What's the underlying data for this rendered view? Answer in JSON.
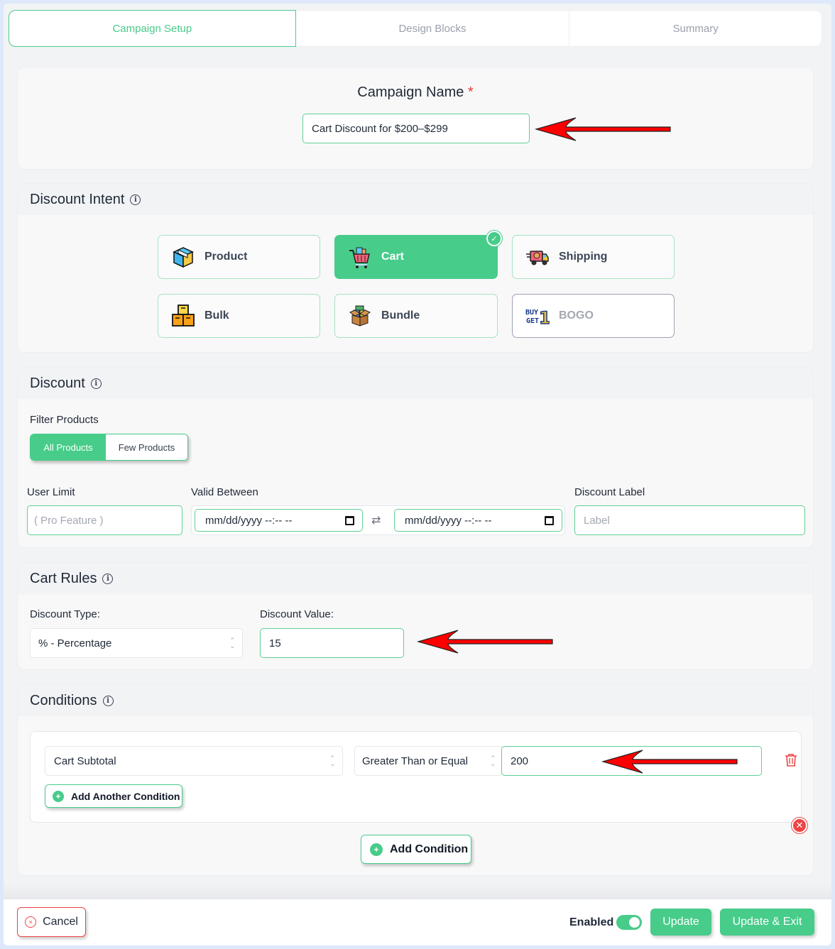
{
  "tabs": [
    {
      "label": "Campaign Setup",
      "active": true
    },
    {
      "label": "Design Blocks",
      "active": false
    },
    {
      "label": "Summary",
      "active": false
    }
  ],
  "campaign_name": {
    "label": "Campaign Name",
    "required_mark": "*",
    "value": "Cart Discount for $200–$299"
  },
  "discount_intent": {
    "title": "Discount Intent",
    "info_icon": "i",
    "options": [
      {
        "label": "Product",
        "icon": "box-icon",
        "state": "default"
      },
      {
        "label": "Cart",
        "icon": "shopping-cart-icon",
        "state": "selected"
      },
      {
        "label": "Shipping",
        "icon": "delivery-truck-icon",
        "state": "default"
      },
      {
        "label": "Bulk",
        "icon": "stacked-boxes-icon",
        "state": "default"
      },
      {
        "label": "Bundle",
        "icon": "open-box-icon",
        "state": "default"
      },
      {
        "label": "BOGO",
        "icon": "buy-get-one-icon",
        "state": "disabled"
      }
    ],
    "check_glyph": "✓"
  },
  "discount": {
    "title": "Discount",
    "filter_label": "Filter Products",
    "filter_options": [
      "All Products",
      "Few Products"
    ],
    "filter_selected": "All Products",
    "user_limit_label": "User Limit",
    "user_limit_placeholder": "( Pro Feature )",
    "valid_between_label": "Valid Between",
    "date_from_placeholder": "mm/dd/yyyy --:-- --",
    "date_to_placeholder": "mm/dd/yyyy --:-- --",
    "swap_glyph": "⇄",
    "label_label": "Discount Label",
    "label_placeholder": "Label"
  },
  "cart_rules": {
    "title": "Cart Rules",
    "type_label": "Discount Type:",
    "type_value": "% - Percentage",
    "value_label": "Discount Value:",
    "value": "15"
  },
  "conditions": {
    "title": "Conditions",
    "rows": [
      {
        "field": "Cart Subtotal",
        "operator": "Greater Than or Equal",
        "value": "200"
      }
    ],
    "add_another_label": "Add Another Condition",
    "add_label": "Add Condition",
    "plus_glyph": "+",
    "close_glyph": "✕"
  },
  "footer": {
    "cancel_label": "Cancel",
    "enabled_label": "Enabled",
    "enabled": true,
    "update_label": "Update",
    "update_exit_label": "Update & Exit",
    "x_glyph": "×"
  },
  "colors": {
    "accent": "#47cc8a",
    "danger": "#ef4444",
    "annotation_arrow": "#ff0000"
  }
}
